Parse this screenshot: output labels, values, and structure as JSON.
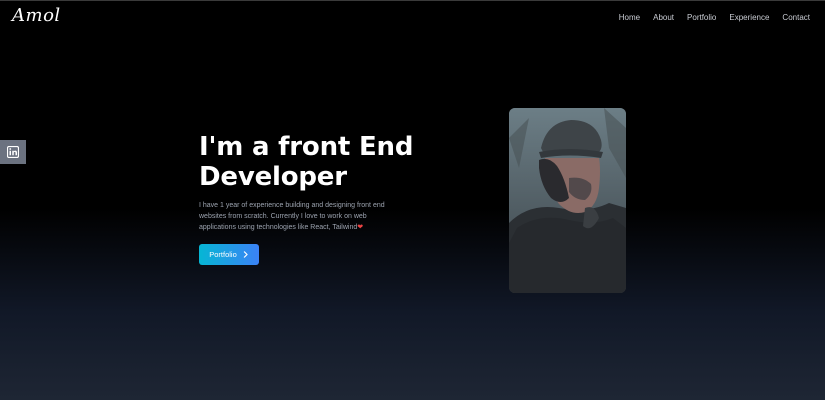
{
  "header": {
    "logo": "Amol",
    "nav": [
      "Home",
      "About",
      "Portfolio",
      "Experience",
      "Contact"
    ]
  },
  "social": {
    "icon": "linkedin-icon"
  },
  "hero": {
    "title_line1": "I'm a front End",
    "title_line2": "Developer",
    "description": "I have 1 year of experience building and designing front end websites from scratch. Currently I love to work on web applications using technologies like React, Tailwind",
    "heart": "❤",
    "button_label": "Portfolio",
    "button_icon": "chevron-right-icon"
  },
  "photo": {
    "subject": "profile-photo"
  },
  "colors": {
    "accent_start": "#06b6d4",
    "accent_end": "#3b82f6",
    "heart": "#ef4444"
  }
}
